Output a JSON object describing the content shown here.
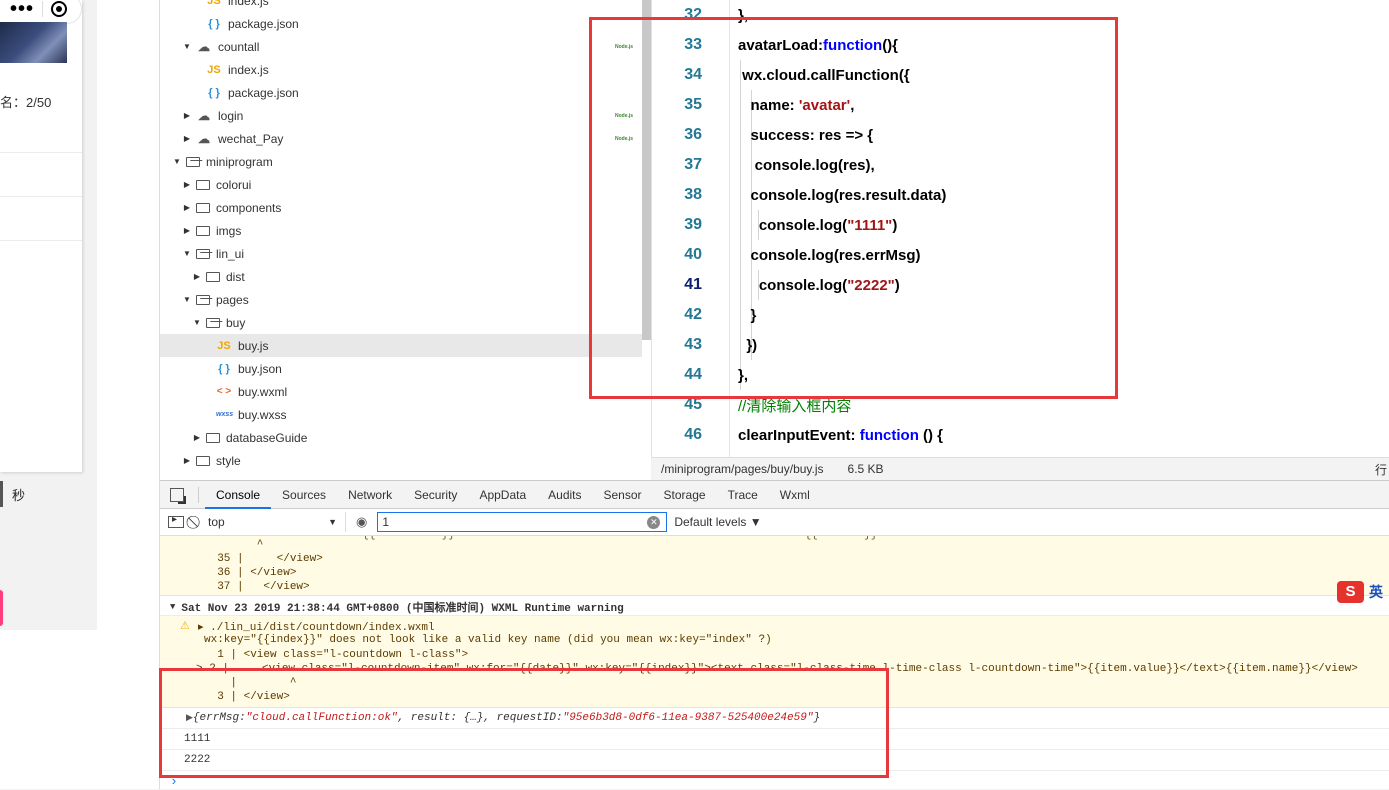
{
  "simulator": {
    "rank_text": "名：2/50",
    "seconds_text": "秒"
  },
  "tree": {
    "items": [
      {
        "label": "index.js",
        "type": "js",
        "indent": 2,
        "arrow": ""
      },
      {
        "label": "package.json",
        "type": "json",
        "indent": 2,
        "arrow": ""
      },
      {
        "label": "countall",
        "type": "cloud",
        "indent": 1,
        "arrow": "open",
        "badge": "Node.js"
      },
      {
        "label": "index.js",
        "type": "js",
        "indent": 2,
        "arrow": ""
      },
      {
        "label": "package.json",
        "type": "json",
        "indent": 2,
        "arrow": ""
      },
      {
        "label": "login",
        "type": "cloud",
        "indent": 1,
        "arrow": "closed",
        "badge": "Node.js"
      },
      {
        "label": "wechat_Pay",
        "type": "cloud",
        "indent": 1,
        "arrow": "closed",
        "badge": "Node.js"
      },
      {
        "label": "miniprogram",
        "type": "folder-open",
        "indent": 0,
        "arrow": "open"
      },
      {
        "label": "colorui",
        "type": "folder",
        "indent": 1,
        "arrow": "closed"
      },
      {
        "label": "components",
        "type": "folder",
        "indent": 1,
        "arrow": "closed"
      },
      {
        "label": "imgs",
        "type": "folder",
        "indent": 1,
        "arrow": "closed"
      },
      {
        "label": "lin_ui",
        "type": "folder-open",
        "indent": 1,
        "arrow": "open"
      },
      {
        "label": "dist",
        "type": "folder",
        "indent": 2,
        "arrow": "closed"
      },
      {
        "label": "pages",
        "type": "folder-open",
        "indent": 1,
        "arrow": "open"
      },
      {
        "label": "buy",
        "type": "folder-open",
        "indent": 2,
        "arrow": "open"
      },
      {
        "label": "buy.js",
        "type": "js",
        "indent": 3,
        "arrow": "",
        "selected": true
      },
      {
        "label": "buy.json",
        "type": "json",
        "indent": 3,
        "arrow": ""
      },
      {
        "label": "buy.wxml",
        "type": "wxml",
        "indent": 3,
        "arrow": ""
      },
      {
        "label": "buy.wxss",
        "type": "wxss",
        "indent": 3,
        "arrow": ""
      },
      {
        "label": "databaseGuide",
        "type": "folder",
        "indent": 2,
        "arrow": "closed"
      },
      {
        "label": "style",
        "type": "folder",
        "indent": 1,
        "arrow": "closed"
      }
    ]
  },
  "editor": {
    "lines": [
      {
        "num": "32",
        "parts": [
          [
            "p",
            "},"
          ]
        ]
      },
      {
        "num": "33",
        "parts": [
          [
            "p",
            "avatarLoad:"
          ],
          [
            "kw",
            "function"
          ],
          [
            "p",
            "(){"
          ]
        ]
      },
      {
        "num": "34",
        "parts": [
          [
            "p",
            " wx.cloud.callFunction({"
          ]
        ]
      },
      {
        "num": "35",
        "parts": [
          [
            "p",
            "   name: "
          ],
          [
            "str",
            "'avatar'"
          ],
          [
            "p",
            ","
          ]
        ]
      },
      {
        "num": "36",
        "parts": [
          [
            "p",
            "   success: res => {"
          ]
        ]
      },
      {
        "num": "37",
        "parts": [
          [
            "p",
            "    console.log(res),"
          ]
        ]
      },
      {
        "num": "38",
        "parts": [
          [
            "p",
            "   console.log(res.result.data)"
          ]
        ]
      },
      {
        "num": "39",
        "parts": [
          [
            "p",
            "     console.log("
          ],
          [
            "str",
            "\"1111\""
          ],
          [
            "p",
            ")"
          ]
        ]
      },
      {
        "num": "40",
        "parts": [
          [
            "p",
            "   console.log(res.errMsg)"
          ]
        ]
      },
      {
        "num": "41",
        "parts": [
          [
            "p",
            "     console.log("
          ],
          [
            "str",
            "\"2222\""
          ],
          [
            "p",
            ")"
          ]
        ],
        "active": true
      },
      {
        "num": "42",
        "parts": [
          [
            "p",
            "   }"
          ]
        ]
      },
      {
        "num": "43",
        "parts": [
          [
            "p",
            "  })"
          ]
        ]
      },
      {
        "num": "44",
        "parts": [
          [
            "p",
            "},"
          ]
        ]
      },
      {
        "num": "45",
        "parts": [
          [
            "cmt",
            "//清除输入框内容"
          ]
        ]
      },
      {
        "num": "46",
        "parts": [
          [
            "p",
            "clearInputEvent: "
          ],
          [
            "kw",
            "function"
          ],
          [
            "p",
            " () {"
          ]
        ]
      }
    ],
    "status_path": "/miniprogram/pages/buy/buy.js",
    "status_size": "6.5 KB",
    "status_extra": "行"
  },
  "devtools": {
    "tabs": [
      "Console",
      "Sources",
      "Network",
      "Security",
      "AppData",
      "Audits",
      "Sensor",
      "Storage",
      "Trace",
      "Wxml"
    ],
    "active_tab": "Console",
    "context": "top",
    "filter_value": "1",
    "levels_label": "Default levels ▼",
    "console": {
      "warn1_lines": [
        "        ^",
        "  35 |     </view>",
        "  36 | </view>",
        "  37 |   </view>"
      ],
      "group_header": "Sat Nov 23 2019 21:38:44 GMT+0800 (中国标准时间) WXML Runtime warning",
      "warn2_path": "▸ ./lin_ui/dist/countdown/index.wxml",
      "warn2_msg": "wx:key=\"{{index}}\" does not look like a valid key name (did you mean wx:key=\"index\" ?)",
      "warn2_l1": "  1 | <view class=\"l-countdown l-class\">",
      "warn2_l2": "> 2 |     <view class=\"l-countdown-item\" wx:for=\"{{date}}\" wx:key=\"{{index}}\"><text class=\"l-class-time l-time-class l-countdown-time\">{{item.value}}</text>{{item.name}}</view>",
      "warn2_caret": "    |        ^",
      "warn2_l3": "  3 | </view>",
      "obj_prefix": "{errMsg: ",
      "obj_errmsg": "\"cloud.callFunction:ok\"",
      "obj_mid": ", result: {…}, requestID: ",
      "obj_reqid": "\"95e6b3d8-0df6-11ea-9387-525400e24e59\"",
      "obj_suffix": "}",
      "log1": "1111",
      "log2": "2222",
      "prompt": "›"
    }
  },
  "ime": {
    "logo": "S",
    "lang": "英"
  }
}
